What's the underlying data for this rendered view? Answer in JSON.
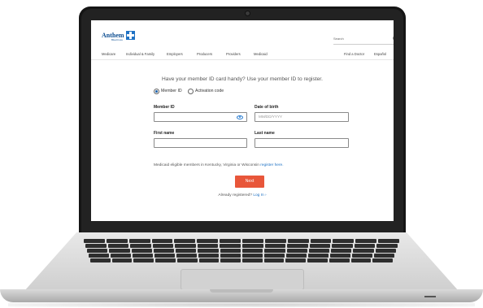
{
  "header": {
    "logo_text": "Anthem",
    "logo_sub": "BlueCross",
    "search_placeholder": "Search",
    "nav": [
      "Medicare",
      "Individual & Family",
      "Employers",
      "Producers",
      "Providers",
      "Medicaid"
    ],
    "nav_right": [
      "Find a Doctor",
      "Español"
    ]
  },
  "form": {
    "prompt": "Have your member ID card handy? Use your member ID to register.",
    "radio_member_id": "Member ID",
    "radio_activation": "Activation code",
    "member_id_label": "Member ID",
    "dob_label": "Date of birth",
    "dob_placeholder": "MM/DD/YYYY",
    "first_name_label": "First name",
    "last_name_label": "Last name",
    "medicaid_note": "Medicaid eligible members in Kentucky, Virginia or Wisconsin",
    "register_link": "register here.",
    "next_button": "Next",
    "already_text": "Already registered?",
    "login_link": "Log In"
  },
  "colors": {
    "brand_blue": "#0f4f92",
    "link_blue": "#1f72c4",
    "next_button": "#e8563a",
    "bezel": "#151515"
  }
}
